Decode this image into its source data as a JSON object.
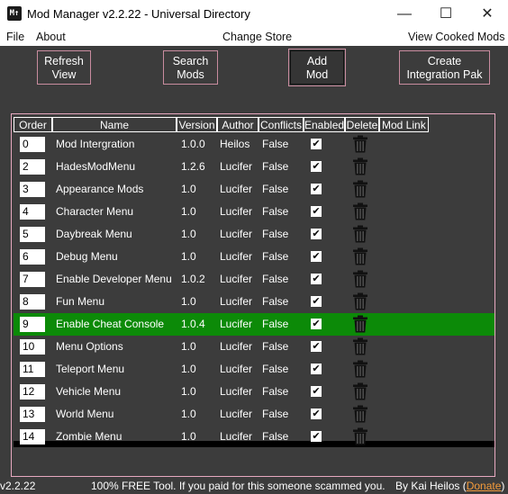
{
  "window": {
    "title": "Mod Manager v2.2.22  - Universal Directory",
    "icon_label": "M↑",
    "minimize": "—",
    "maximize": "☐",
    "close": "✕"
  },
  "menu": {
    "file": "File",
    "about": "About",
    "change_store": "Change Store",
    "view_cooked": "View Cooked Mods"
  },
  "toolbar": {
    "refresh_line1": "Refresh",
    "refresh_line2": "View",
    "search_line1": "Search",
    "search_line2": "Mods",
    "add_line1": "Add",
    "add_line2": "Mod",
    "create_line1": "Create",
    "create_line2": "Integration Pak"
  },
  "table": {
    "headers": [
      "Order",
      "Name",
      "Version",
      "Author",
      "Conflicts",
      "Enabled",
      "Delete",
      "Mod Link"
    ],
    "rows": [
      {
        "order": "0",
        "name": "Mod Intergration",
        "version": "1.0.0",
        "author": "Heilos",
        "conflicts": "False",
        "enabled": "✔"
      },
      {
        "order": "2",
        "name": "HadesModMenu",
        "version": "1.2.6",
        "author": "Lucifer",
        "conflicts": "False",
        "enabled": "✔"
      },
      {
        "order": "3",
        "name": "Appearance Mods",
        "version": "1.0",
        "author": "Lucifer",
        "conflicts": "False",
        "enabled": "✔"
      },
      {
        "order": "4",
        "name": "Character Menu",
        "version": "1.0",
        "author": "Lucifer",
        "conflicts": "False",
        "enabled": "✔"
      },
      {
        "order": "5",
        "name": "Daybreak Menu",
        "version": "1.0",
        "author": "Lucifer",
        "conflicts": "False",
        "enabled": "✔"
      },
      {
        "order": "6",
        "name": "Debug Menu",
        "version": "1.0",
        "author": "Lucifer",
        "conflicts": "False",
        "enabled": "✔"
      },
      {
        "order": "7",
        "name": "Enable Developer Menu",
        "version": "1.0.2",
        "author": "Lucifer",
        "conflicts": "False",
        "enabled": "✔"
      },
      {
        "order": "8",
        "name": "Fun Menu",
        "version": "1.0",
        "author": "Lucifer",
        "conflicts": "False",
        "enabled": "✔"
      },
      {
        "order": "9",
        "name": "Enable Cheat Console",
        "version": "1.0.4",
        "author": "Lucifer",
        "conflicts": "False",
        "enabled": "✔"
      },
      {
        "order": "10",
        "name": "Menu Options",
        "version": "1.0",
        "author": "Lucifer",
        "conflicts": "False",
        "enabled": "✔"
      },
      {
        "order": "11",
        "name": "Teleport Menu",
        "version": "1.0",
        "author": "Lucifer",
        "conflicts": "False",
        "enabled": "✔"
      },
      {
        "order": "12",
        "name": "Vehicle Menu",
        "version": "1.0",
        "author": "Lucifer",
        "conflicts": "False",
        "enabled": "✔"
      },
      {
        "order": "13",
        "name": "World Menu",
        "version": "1.0",
        "author": "Lucifer",
        "conflicts": "False",
        "enabled": "✔"
      },
      {
        "order": "14",
        "name": "Zombie Menu",
        "version": "1.0",
        "author": "Lucifer",
        "conflicts": "False",
        "enabled": "✔"
      }
    ]
  },
  "status": {
    "version": "v2.2.22",
    "message": "100% FREE Tool. If you paid for this someone scammed you.",
    "by": "By Kai Heilos (",
    "donate": "Donate",
    "close_paren": ")"
  },
  "colors": {
    "background": "#3c3c3c",
    "accent_border": "#c98c9f",
    "selected_row": "#0c8a08",
    "donate_link": "#f49b3b"
  }
}
